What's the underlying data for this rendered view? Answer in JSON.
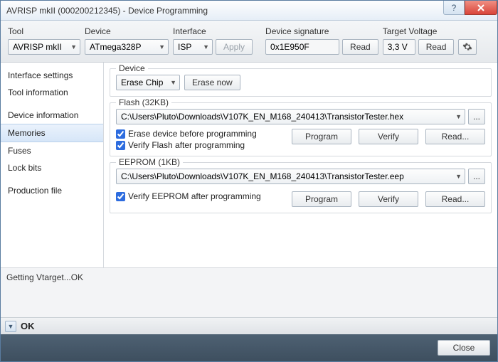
{
  "window": {
    "title": "AVRISP mkII (000200212345) - Device Programming"
  },
  "toolbar": {
    "tool_label": "Tool",
    "tool_value": "AVRISP mkII",
    "device_label": "Device",
    "device_value": "ATmega328P",
    "interface_label": "Interface",
    "interface_value": "ISP",
    "apply": "Apply",
    "sig_label": "Device signature",
    "sig_value": "0x1E950F",
    "sig_read": "Read",
    "volt_label": "Target Voltage",
    "volt_value": "3,3 V",
    "volt_read": "Read"
  },
  "sidebar": {
    "items": [
      {
        "label": "Interface settings"
      },
      {
        "label": "Tool information"
      },
      {
        "label": "Device information"
      },
      {
        "label": "Memories"
      },
      {
        "label": "Fuses"
      },
      {
        "label": "Lock bits"
      },
      {
        "label": "Production file"
      }
    ]
  },
  "panel": {
    "device": {
      "legend": "Device",
      "erase_chip": "Erase Chip",
      "erase_now": "Erase now"
    },
    "flash": {
      "legend": "Flash (32KB)",
      "path": "C:\\Users\\Pluto\\Downloads\\V107K_EN_M168_240413\\TransistorTester.hex",
      "browse": "...",
      "chk_erase": "Erase device before programming",
      "chk_verify": "Verify Flash after programming",
      "program": "Program",
      "verify": "Verify",
      "read": "Read..."
    },
    "eeprom": {
      "legend": "EEPROM (1KB)",
      "path": "C:\\Users\\Pluto\\Downloads\\V107K_EN_M168_240413\\TransistorTester.eep",
      "browse": "...",
      "chk_verify": "Verify EEPROM after programming",
      "program": "Program",
      "verify": "Verify",
      "read": "Read..."
    }
  },
  "status": {
    "text": "Getting Vtarget...OK",
    "ok": "OK"
  },
  "footer": {
    "close": "Close"
  }
}
